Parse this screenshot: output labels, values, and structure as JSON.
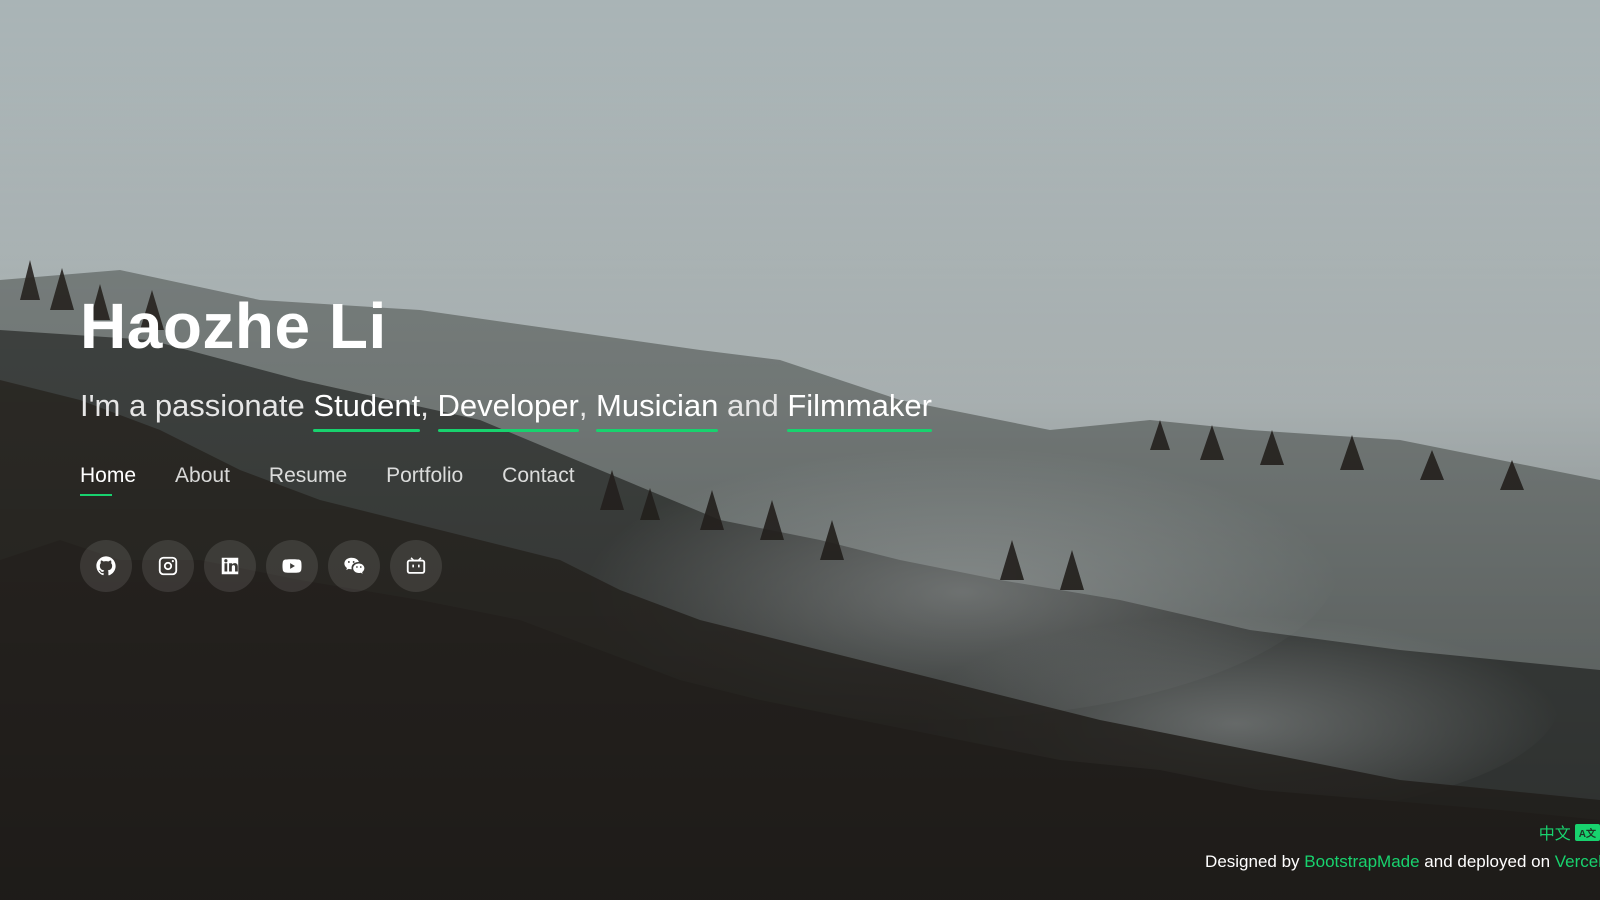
{
  "hero": {
    "name": "Haozhe Li",
    "tagline_prefix": "I'm a passionate ",
    "roles": {
      "r1": "Student",
      "r2": "Developer",
      "r3": "Musician",
      "r4": "Filmmaker"
    },
    "separators": {
      "comma": ", ",
      "and": " and "
    }
  },
  "nav": {
    "items": [
      "Home",
      "About",
      "Resume",
      "Portfolio",
      "Contact"
    ],
    "active": "Home"
  },
  "socials": {
    "icons": [
      "github-icon",
      "instagram-icon",
      "linkedin-icon",
      "youtube-icon",
      "wechat-icon",
      "bilibili-icon"
    ]
  },
  "footer": {
    "language_label": "中文",
    "language_badge": "A文",
    "credits_prefix": "Designed by ",
    "credits_link1": "BootstrapMade",
    "credits_middle": " and deployed on ",
    "credits_link2": "Vercel"
  },
  "colors": {
    "accent": "#18d26e",
    "text": "#ffffff"
  }
}
